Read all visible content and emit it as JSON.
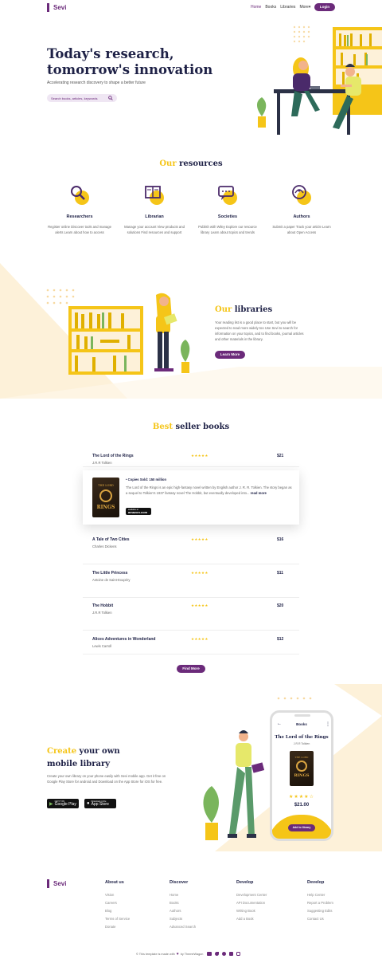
{
  "header": {
    "brand": "Sevi",
    "nav": [
      "Home",
      "Books",
      "Libraries",
      "More"
    ],
    "login": "Login"
  },
  "hero": {
    "title_line1": "Today's research,",
    "title_line2": "tomorrow's innovation",
    "subtitle": "Accelerating research discovery to shape a better future",
    "search_placeholder": "Search books, articles, keywords"
  },
  "resources": {
    "title_accent": "Our",
    "title_rest": "resources",
    "items": [
      {
        "title": "Researchers",
        "desc": "Register online Discover tools and manage alerts Learn about how to access",
        "icon": "magnifier-icon"
      },
      {
        "title": "Librarian",
        "desc": "Manage your account View products and solutions Find resources and support",
        "icon": "book-icon"
      },
      {
        "title": "Societies",
        "desc": "Publish with Wiley Explore our resource library Learn about topics and trends",
        "icon": "chat-icon"
      },
      {
        "title": "Authors",
        "desc": "Submit a paper Track your article Learn about Open Access",
        "icon": "compass-icon"
      }
    ]
  },
  "libraries": {
    "title_accent": "Our",
    "title_rest": "libraries",
    "text": "Your reading list is a good place to start, but you will be expected to read more widely too Use Sevi to search for information on your topics, and to find books, journal articles and other materials in the library.",
    "button": "Learn More"
  },
  "bestsellers": {
    "title_accent": "Best",
    "title_rest": "seller books",
    "stars": "★★★★★",
    "books": [
      {
        "title": "The Lord of the Rings",
        "author": "J.R.R Tolkien",
        "price": "$21"
      },
      {
        "title": "A Tale of Two Cities",
        "author": "Charles Dickens",
        "price": "$16"
      },
      {
        "title": "The Little Princess",
        "author": "Antoine de Saint-Exupéry",
        "price": "$11"
      },
      {
        "title": "The Hobbit",
        "author": "J.R.R Tolkien",
        "price": "$20"
      },
      {
        "title": "Alices Adventures in Wonderland",
        "author": "Lewis Carroll",
        "price": "$12"
      }
    ],
    "detail": {
      "copies": "Copies Sold: 150 million",
      "text": "The Lord of the Rings is an epic high-fantasy novel written by English author J. R. R. Tolkien. The story began as a sequel to Tolkien's 1937 fantasy novel The Hobbit, but eventually developed into...",
      "read_more": "read more",
      "cover_top": "THE LORD",
      "cover_mid": "RINGS",
      "store_small": "available at",
      "store": "amazon.com"
    },
    "find_more": "Find More"
  },
  "mobile": {
    "title_accent": "Create",
    "title_rest1": "your own",
    "title_rest2": "mobile library",
    "text": "Create your own library on your phone easily with Sevi mobile app. Get it free on Google Play Store for android and Download on the App Store for iOS for free.",
    "google_small": "GET IT ON",
    "google": "Google Play",
    "apple_small": "Download on the",
    "apple": "App Store",
    "phone": {
      "header": "Books",
      "title": "The Lord of the Rings",
      "author": "J.R.R Tolkien",
      "stars": "★★★★☆",
      "price": "$21.00",
      "button": "Add to library"
    }
  },
  "footer": {
    "brand": "Sevi",
    "columns": [
      {
        "title": "About us",
        "links": [
          "Vision",
          "Careers",
          "Blog",
          "Terms of Service",
          "Donate"
        ]
      },
      {
        "title": "Discover",
        "links": [
          "Home",
          "Books",
          "Authors",
          "Subjects",
          "Advanced Search"
        ]
      },
      {
        "title": "Develop",
        "links": [
          "Development Center",
          "API Documentation",
          "Writing Book",
          "Add a Book"
        ]
      },
      {
        "title": "Develop",
        "links": [
          "Help Center",
          "Report a Problem",
          "Suggesting Edits",
          "Contact Us"
        ]
      }
    ],
    "credit_pre": "© This template is made with",
    "credit_post": "by ThemeWagon"
  },
  "colors": {
    "purple": "#6b2a7a",
    "gold": "#f5c518",
    "navy": "#1e2146",
    "cream": "#fdf1d9"
  }
}
